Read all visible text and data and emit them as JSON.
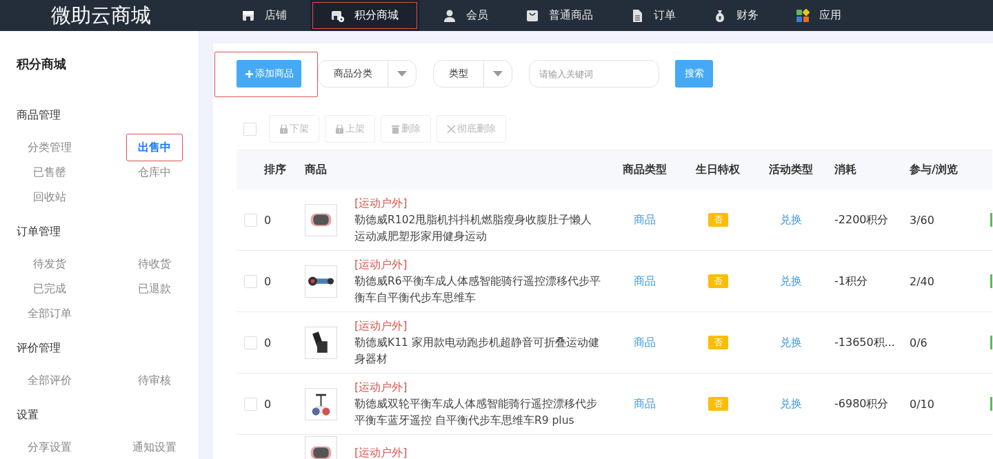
{
  "brand": "微助云商城",
  "nav": [
    {
      "label": "店铺",
      "selected": false,
      "highlighted": false
    },
    {
      "label": "积分商城",
      "selected": true,
      "highlighted": true
    },
    {
      "label": "会员",
      "selected": false,
      "highlighted": false
    },
    {
      "label": "普通商品",
      "selected": false,
      "highlighted": false
    },
    {
      "label": "订单",
      "selected": false,
      "highlighted": false
    },
    {
      "label": "财务",
      "selected": false,
      "highlighted": false
    },
    {
      "label": "应用",
      "selected": false,
      "highlighted": false
    }
  ],
  "sidebar": {
    "title": "积分商城",
    "sections": [
      {
        "title": "商品管理",
        "items": [
          {
            "label": "分类管理",
            "selected": false,
            "highlighted": false
          },
          {
            "label": "出售中",
            "selected": true,
            "highlighted": true
          },
          {
            "label": "已售罄",
            "selected": false,
            "highlighted": false
          },
          {
            "label": "仓库中",
            "selected": false,
            "highlighted": false
          },
          {
            "label": "回收站",
            "selected": false,
            "highlighted": false
          }
        ]
      },
      {
        "title": "订单管理",
        "items": [
          {
            "label": "待发货",
            "selected": false,
            "highlighted": false
          },
          {
            "label": "待收货",
            "selected": false,
            "highlighted": false
          },
          {
            "label": "已完成",
            "selected": false,
            "highlighted": false
          },
          {
            "label": "已退款",
            "selected": false,
            "highlighted": false
          },
          {
            "label": "全部订单",
            "selected": false,
            "highlighted": false
          }
        ]
      },
      {
        "title": "评价管理",
        "items": [
          {
            "label": "全部评价",
            "selected": false,
            "highlighted": false
          },
          {
            "label": "待审核",
            "selected": false,
            "highlighted": false
          }
        ]
      },
      {
        "title": "设置",
        "items": [
          {
            "label": "分享设置",
            "selected": false,
            "highlighted": false
          },
          {
            "label": "通知设置",
            "selected": false,
            "highlighted": false
          }
        ]
      }
    ]
  },
  "toolbar": {
    "add_button": {
      "label": "添加商品",
      "highlighted": true
    },
    "category_select": "商品分类",
    "type_select": "类型",
    "search": {
      "placeholder": "请输入关键词"
    },
    "search_button": "搜索"
  },
  "select_all": {
    "checked": false
  },
  "bulk_actions": [
    "下架",
    "上架",
    "删除",
    "彻底删除"
  ],
  "table": {
    "columns": [
      "排序",
      "商品",
      "商品类型",
      "生日特权",
      "活动类型",
      "消耗",
      "参与/浏览"
    ],
    "rows": [
      {
        "checked": false,
        "sort": "0",
        "category": "[运动户外]",
        "name": "勒德威R102甩脂机抖抖机燃脂瘦身收腹肚子懒人运动减肥塑形家用健身运动",
        "type": "商品",
        "birthday": "否",
        "activity": "兑换",
        "cost": "-2200积分",
        "participation": "3/60",
        "on": true
      },
      {
        "checked": false,
        "sort": "0",
        "category": "[运动户外]",
        "name": "勒德威R6平衡车成人体感智能骑行遥控漂移代步平衡车自平衡代步车思维车",
        "type": "商品",
        "birthday": "否",
        "activity": "兑换",
        "cost": "-1积分",
        "participation": "2/40",
        "on": true
      },
      {
        "checked": false,
        "sort": "0",
        "category": "[运动户外]",
        "name": "勒德威K11 家用款电动跑步机超静音可折叠运动健身器材",
        "type": "商品",
        "birthday": "否",
        "activity": "兑换",
        "cost": "-13650积...",
        "participation": "0/6",
        "on": true
      },
      {
        "checked": false,
        "sort": "0",
        "category": "[运动户外]",
        "name": "勒德威双轮平衡车成人体感智能骑行遥控漂移代步平衡车蓝牙遥控 自平衡代步车思维车R9 plus",
        "type": "商品",
        "birthday": "否",
        "activity": "兑换",
        "cost": "-6980积分",
        "participation": "0/10",
        "on": true
      },
      {
        "category": "[运动户外]"
      }
    ]
  }
}
